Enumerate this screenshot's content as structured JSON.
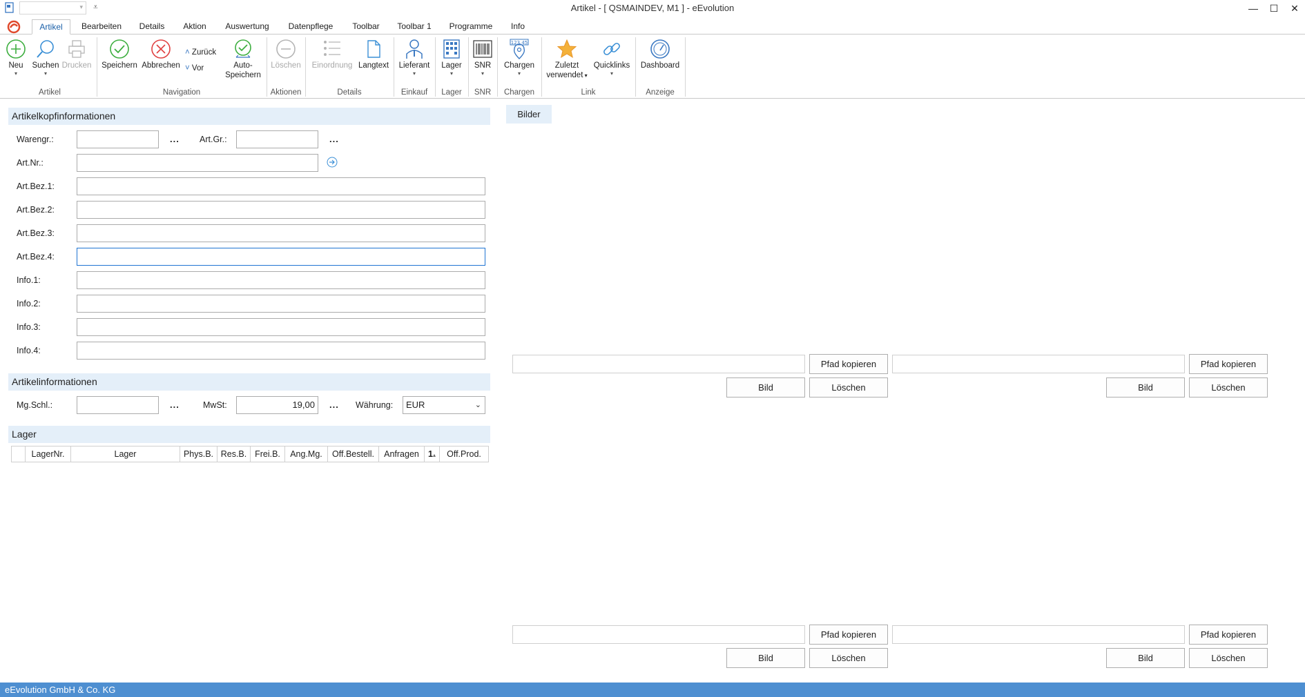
{
  "window": {
    "title": "Artikel - [ QSMAINDEV, M1 ]  -  eEvolution",
    "minimize": "—",
    "maximize": "☐",
    "close": "✕",
    "qat_more": "⩡"
  },
  "tabs": [
    "Artikel",
    "Bearbeiten",
    "Details",
    "Aktion",
    "Auswertung",
    "Datenpflege",
    "Toolbar",
    "Toolbar 1",
    "Programme",
    "Info"
  ],
  "ribbon": {
    "neu": "Neu",
    "suchen": "Suchen",
    "drucken": "Drucken",
    "speichern": "Speichern",
    "abbrechen": "Abbrechen",
    "zurueck": "Zurück",
    "vor": "Vor",
    "auto_line1": "Auto-",
    "auto_line2": "Speichern",
    "loeschen": "Löschen",
    "einordnung": "Einordnung",
    "langtext": "Langtext",
    "lieferant": "Lieferant",
    "lager": "Lager",
    "snr": "SNR",
    "chargen": "Chargen",
    "chargen_badge": "123 45",
    "zuletzt_line1": "Zuletzt",
    "zuletzt_line2": "verwendet",
    "quicklinks": "Quicklinks",
    "dashboard": "Dashboard",
    "groups": {
      "artikel": "Artikel",
      "navigation": "Navigation",
      "aktionen": "Aktionen",
      "details": "Details",
      "einkauf": "Einkauf",
      "lager": "Lager",
      "snr": "SNR",
      "chargen": "Chargen",
      "link": "Link",
      "anzeige": "Anzeige"
    }
  },
  "form": {
    "kopf_title": "Artikelkopfinformationen",
    "warengr": "Warengr.:",
    "artgr": "Art.Gr.:",
    "artnr": "Art.Nr.:",
    "bez1": "Art.Bez.1:",
    "bez2": "Art.Bez.2:",
    "bez3": "Art.Bez.3:",
    "bez4": "Art.Bez.4:",
    "info1": "Info.1:",
    "info2": "Info.2:",
    "info3": "Info.3:",
    "info4": "Info.4:",
    "dots": "...",
    "info_title": "Artikelinformationen",
    "mgschl": "Mg.Schl.:",
    "mwst": "MwSt:",
    "mwst_value": "19,00",
    "waehrung": "Währung:",
    "waehrung_value": "EUR"
  },
  "lager": {
    "title": "Lager",
    "columns": [
      "LagerNr.",
      "Lager",
      "Phys.B.",
      "Res.B.",
      "Frei.B.",
      "Ang.Mg.",
      "Off.Bestell.",
      "Anfragen",
      "1",
      "Off.Prod."
    ]
  },
  "bilder": {
    "tab": "Bilder",
    "pfad_kopieren": "Pfad kopieren",
    "bild": "Bild",
    "loeschen": "Löschen"
  },
  "status": {
    "text": "eEvolution GmbH & Co. KG"
  }
}
